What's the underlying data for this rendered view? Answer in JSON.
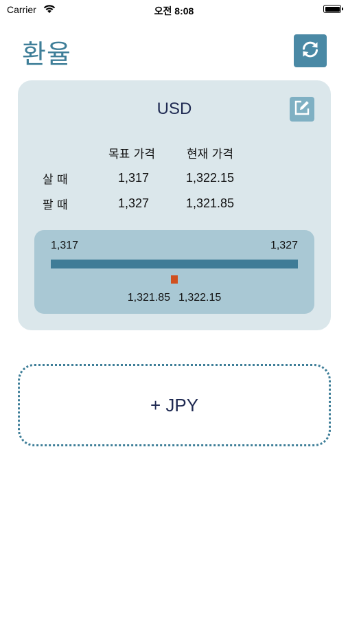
{
  "status_bar": {
    "carrier": "Carrier",
    "time": "오전 8:08",
    "battery_level": 1.0
  },
  "header": {
    "title": "환율",
    "refresh_icon": "refresh-icon"
  },
  "card": {
    "currency_code": "USD",
    "edit_icon": "edit-icon",
    "columns": [
      "목표 가격",
      "현재 가격"
    ],
    "rows": [
      {
        "label": "살 때",
        "target": "1,317",
        "current": "1,322.15"
      },
      {
        "label": "팔 때",
        "target": "1,327",
        "current": "1,321.85"
      }
    ],
    "range": {
      "min_label": "1,317",
      "max_label": "1,327",
      "min": 1317,
      "max": 1327,
      "marker_value": 1322.0,
      "sell_label": "1,321.85",
      "buy_label": "1,322.15"
    }
  },
  "add_card": {
    "label": "+ JPY"
  },
  "colors": {
    "accent": "#3e7e98",
    "card_bg": "#dbe7eb",
    "range_bg": "#a9c8d4",
    "marker": "#d0501f",
    "heading_text": "#1f2a52"
  }
}
